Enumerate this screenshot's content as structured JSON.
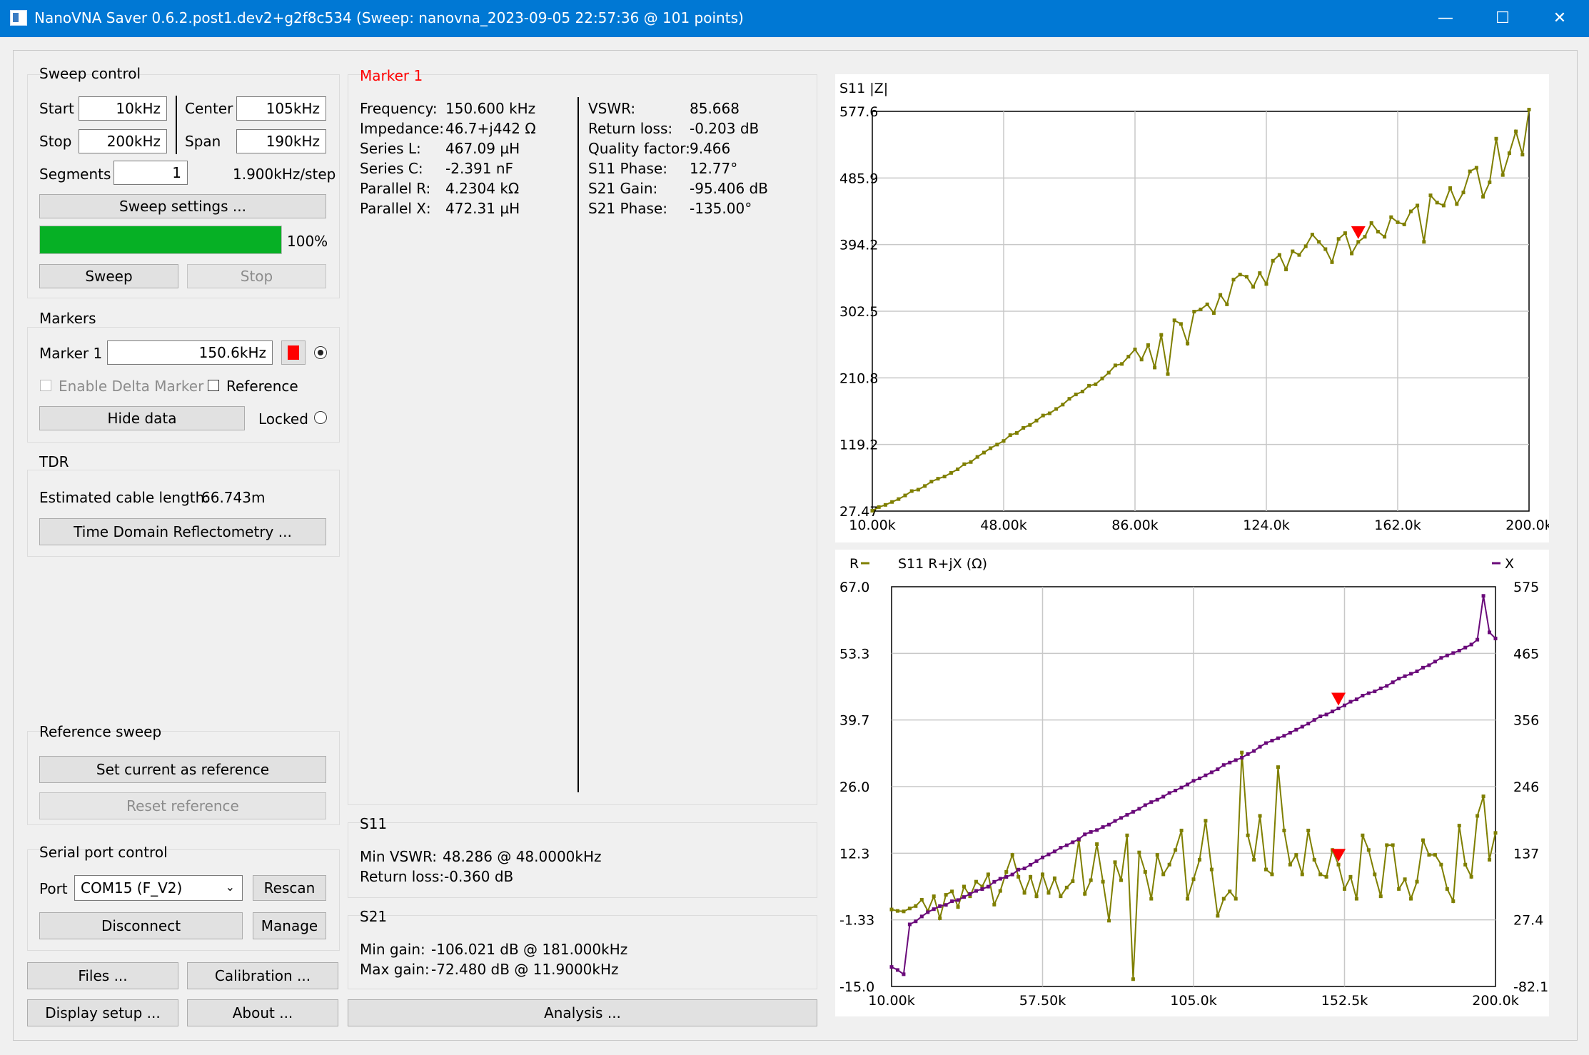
{
  "window": {
    "title": "NanoVNA Saver 0.6.2.post1.dev2+g2f8c534 (Sweep: nanovna_2023-09-05 22:57:36 @ 101 points)",
    "minimize": "—",
    "maximize": "☐",
    "close": "✕"
  },
  "sweep_control": {
    "title": "Sweep control",
    "start_label": "Start",
    "start_value": "10kHz",
    "stop_label": "Stop",
    "stop_value": "200kHz",
    "center_label": "Center",
    "center_value": "105kHz",
    "span_label": "Span",
    "span_value": "190kHz",
    "segments_label": "Segments",
    "segments_value": "1",
    "step_text": "1.900kHz/step",
    "settings_button": "Sweep settings ...",
    "progress": 100,
    "progress_text": "100%",
    "sweep_button": "Sweep",
    "stop_button": "Stop"
  },
  "markers": {
    "title": "Markers",
    "marker1_label": "Marker 1",
    "marker1_value": "150.6kHz",
    "marker1_color": "#ff0000",
    "delta_label": "Enable Delta Marker",
    "reference_label": "Reference",
    "hide_button": "Hide data",
    "locked_label": "Locked"
  },
  "tdr": {
    "title": "TDR",
    "cable_label": "Estimated cable length:",
    "cable_value": "66.743m",
    "button": "Time Domain Reflectometry ..."
  },
  "reference_sweep": {
    "title": "Reference sweep",
    "set_button": "Set current as reference",
    "reset_button": "Reset reference"
  },
  "serial": {
    "title": "Serial port control",
    "port_label": "Port",
    "port_value": "COM15 (F_V2)",
    "rescan_button": "Rescan",
    "disconnect_button": "Disconnect",
    "manage_button": "Manage"
  },
  "bottom_buttons": {
    "files": "Files ...",
    "calibration": "Calibration ...",
    "display": "Display setup ...",
    "about": "About ...",
    "analysis": "Analysis ..."
  },
  "marker_panel": {
    "title": "Marker 1",
    "left": [
      {
        "label": "Frequency:",
        "value": "150.600 kHz"
      },
      {
        "label": "Impedance:",
        "value": "46.7+j442 Ω"
      },
      {
        "label": "Series L:",
        "value": "467.09 µH"
      },
      {
        "label": "Series C:",
        "value": "-2.391 nF"
      },
      {
        "label": "Parallel R:",
        "value": "4.2304 kΩ"
      },
      {
        "label": "Parallel X:",
        "value": "472.31 µH"
      }
    ],
    "right": [
      {
        "label": "VSWR:",
        "value": "85.668"
      },
      {
        "label": "Return loss:",
        "value": "-0.203 dB"
      },
      {
        "label": "Quality factor:",
        "value": "9.466"
      },
      {
        "label": "S11 Phase:",
        "value": "12.77°"
      },
      {
        "label": "S21 Gain:",
        "value": "-95.406 dB"
      },
      {
        "label": "S21 Phase:",
        "value": "-135.00°"
      }
    ]
  },
  "s11_panel": {
    "title": "S11",
    "vswr_label": "Min VSWR:",
    "vswr_value": "48.286 @ 48.0000kHz",
    "rl_label": "Return loss:",
    "rl_value": "-0.360 dB"
  },
  "s21_panel": {
    "title": "S21",
    "min_label": "Min gain:",
    "min_value": "-106.021 dB @ 181.000kHz",
    "max_label": "Max gain:",
    "max_value": "-72.480 dB @ 11.9000kHz"
  },
  "colors": {
    "trace_r": "#7f7f00",
    "trace_x": "#6a0a7a",
    "marker": "#ff0000",
    "progress": "#06b025",
    "titlebar": "#0078d4"
  },
  "chart_data": [
    {
      "type": "line",
      "title": "S11 |Z|",
      "xlim": [
        10000,
        200000
      ],
      "ylim": [
        27.47,
        577.6
      ],
      "x_ticks": [
        "10.00k",
        "48.00k",
        "86.00k",
        "124.0k",
        "162.0k",
        "200.0k"
      ],
      "y_ticks": [
        "577.6",
        "485.9",
        "394.2",
        "302.5",
        "210.8",
        "119.2",
        "27.47"
      ],
      "grid": true,
      "marker_x": 150600,
      "series": [
        {
          "values": [
            28,
            33,
            36,
            40,
            44,
            49,
            55,
            57,
            62,
            68,
            72,
            75,
            80,
            85,
            92,
            95,
            102,
            108,
            114,
            119,
            124,
            132,
            135,
            142,
            146,
            152,
            159,
            162,
            168,
            174,
            182,
            188,
            192,
            200,
            202,
            210,
            218,
            228,
            230,
            240,
            250,
            236,
            256,
            225,
            270,
            216,
            290,
            285,
            258,
            302,
            305,
            312,
            300,
            325,
            312,
            346,
            353,
            350,
            336,
            355,
            340,
            372,
            380,
            360,
            385,
            380,
            392,
            408,
            398,
            388,
            370,
            402,
            410,
            382,
            398,
            405,
            424,
            412,
            405,
            432,
            425,
            422,
            440,
            448,
            398,
            462,
            452,
            448,
            472,
            450,
            466,
            495,
            500,
            460,
            480,
            540,
            490,
            520,
            550,
            518,
            580
          ]
        }
      ]
    },
    {
      "type": "line",
      "title": "S11 R+jX (Ω)",
      "xlim": [
        10000,
        200000
      ],
      "ylim": [
        -15.0,
        67.0
      ],
      "y2lim": [
        -82.1,
        575
      ],
      "x_ticks": [
        "10.00k",
        "57.50k",
        "105.0k",
        "152.5k",
        "200.0k"
      ],
      "y_ticks": [
        "67.0",
        "53.3",
        "39.7",
        "26.0",
        "12.3",
        "-1.33",
        "-15.0"
      ],
      "y2_ticks": [
        "575",
        "465",
        "356",
        "246",
        "137",
        "27.4",
        "-82.1"
      ],
      "grid": true,
      "marker_x": 150600,
      "series": [
        {
          "name": "R",
          "values": [
            0.8,
            0.5,
            0.4,
            1.0,
            1.5,
            2.8,
            0.5,
            3.5,
            -1.0,
            3.8,
            4.5,
            1.3,
            5.5,
            3.5,
            6.5,
            5.5,
            8.0,
            1.8,
            4.6,
            8.5,
            12.0,
            7.5,
            4.2,
            7.5,
            3.5,
            8.0,
            4.2,
            7.2,
            3.5,
            5.3,
            6.6,
            15.0,
            4.0,
            6.8,
            14.2,
            6.5,
            -1.5,
            10.5,
            6.8,
            16.0,
            -13.5,
            12.5,
            8.5,
            3.0,
            12.0,
            8.0,
            10.0,
            13.0,
            17.0,
            3.0,
            7.0,
            11.0,
            19.0,
            9.0,
            -0.5,
            3.0,
            4.5,
            3.0,
            33.0,
            16.0,
            11.0,
            20.0,
            9.0,
            8.0,
            30.0,
            17.0,
            10.0,
            12.0,
            8.0,
            17.0,
            11.0,
            8.0,
            7.5,
            13.0,
            10.0,
            5.0,
            7.5,
            3.0,
            16.0,
            13.0,
            8.0,
            3.5,
            14.0,
            14.0,
            5.0,
            7.0,
            3.0,
            6.5,
            15.0,
            12.0,
            12.0,
            10.0,
            5.0,
            2.5,
            18.0,
            10.0,
            7.5,
            20.0,
            24.0,
            11.0,
            16.5
          ]
        },
        {
          "name": "X",
          "values": [
            -50,
            -55,
            -62,
            20,
            25,
            33,
            40,
            45,
            50,
            52,
            58,
            60,
            65,
            70,
            75,
            78,
            82,
            90,
            95,
            98,
            102,
            110,
            112,
            118,
            124,
            130,
            135,
            140,
            146,
            150,
            155,
            160,
            168,
            172,
            175,
            180,
            184,
            190,
            195,
            200,
            205,
            210,
            216,
            221,
            225,
            230,
            236,
            240,
            245,
            250,
            256,
            260,
            265,
            270,
            275,
            282,
            286,
            290,
            294,
            300,
            305,
            312,
            318,
            322,
            326,
            330,
            335,
            340,
            345,
            350,
            356,
            362,
            365,
            370,
            375,
            380,
            386,
            390,
            396,
            400,
            403,
            408,
            412,
            418,
            424,
            428,
            432,
            436,
            442,
            446,
            452,
            458,
            462,
            466,
            470,
            475,
            480,
            488,
            560,
            500,
            490
          ]
        }
      ]
    }
  ]
}
